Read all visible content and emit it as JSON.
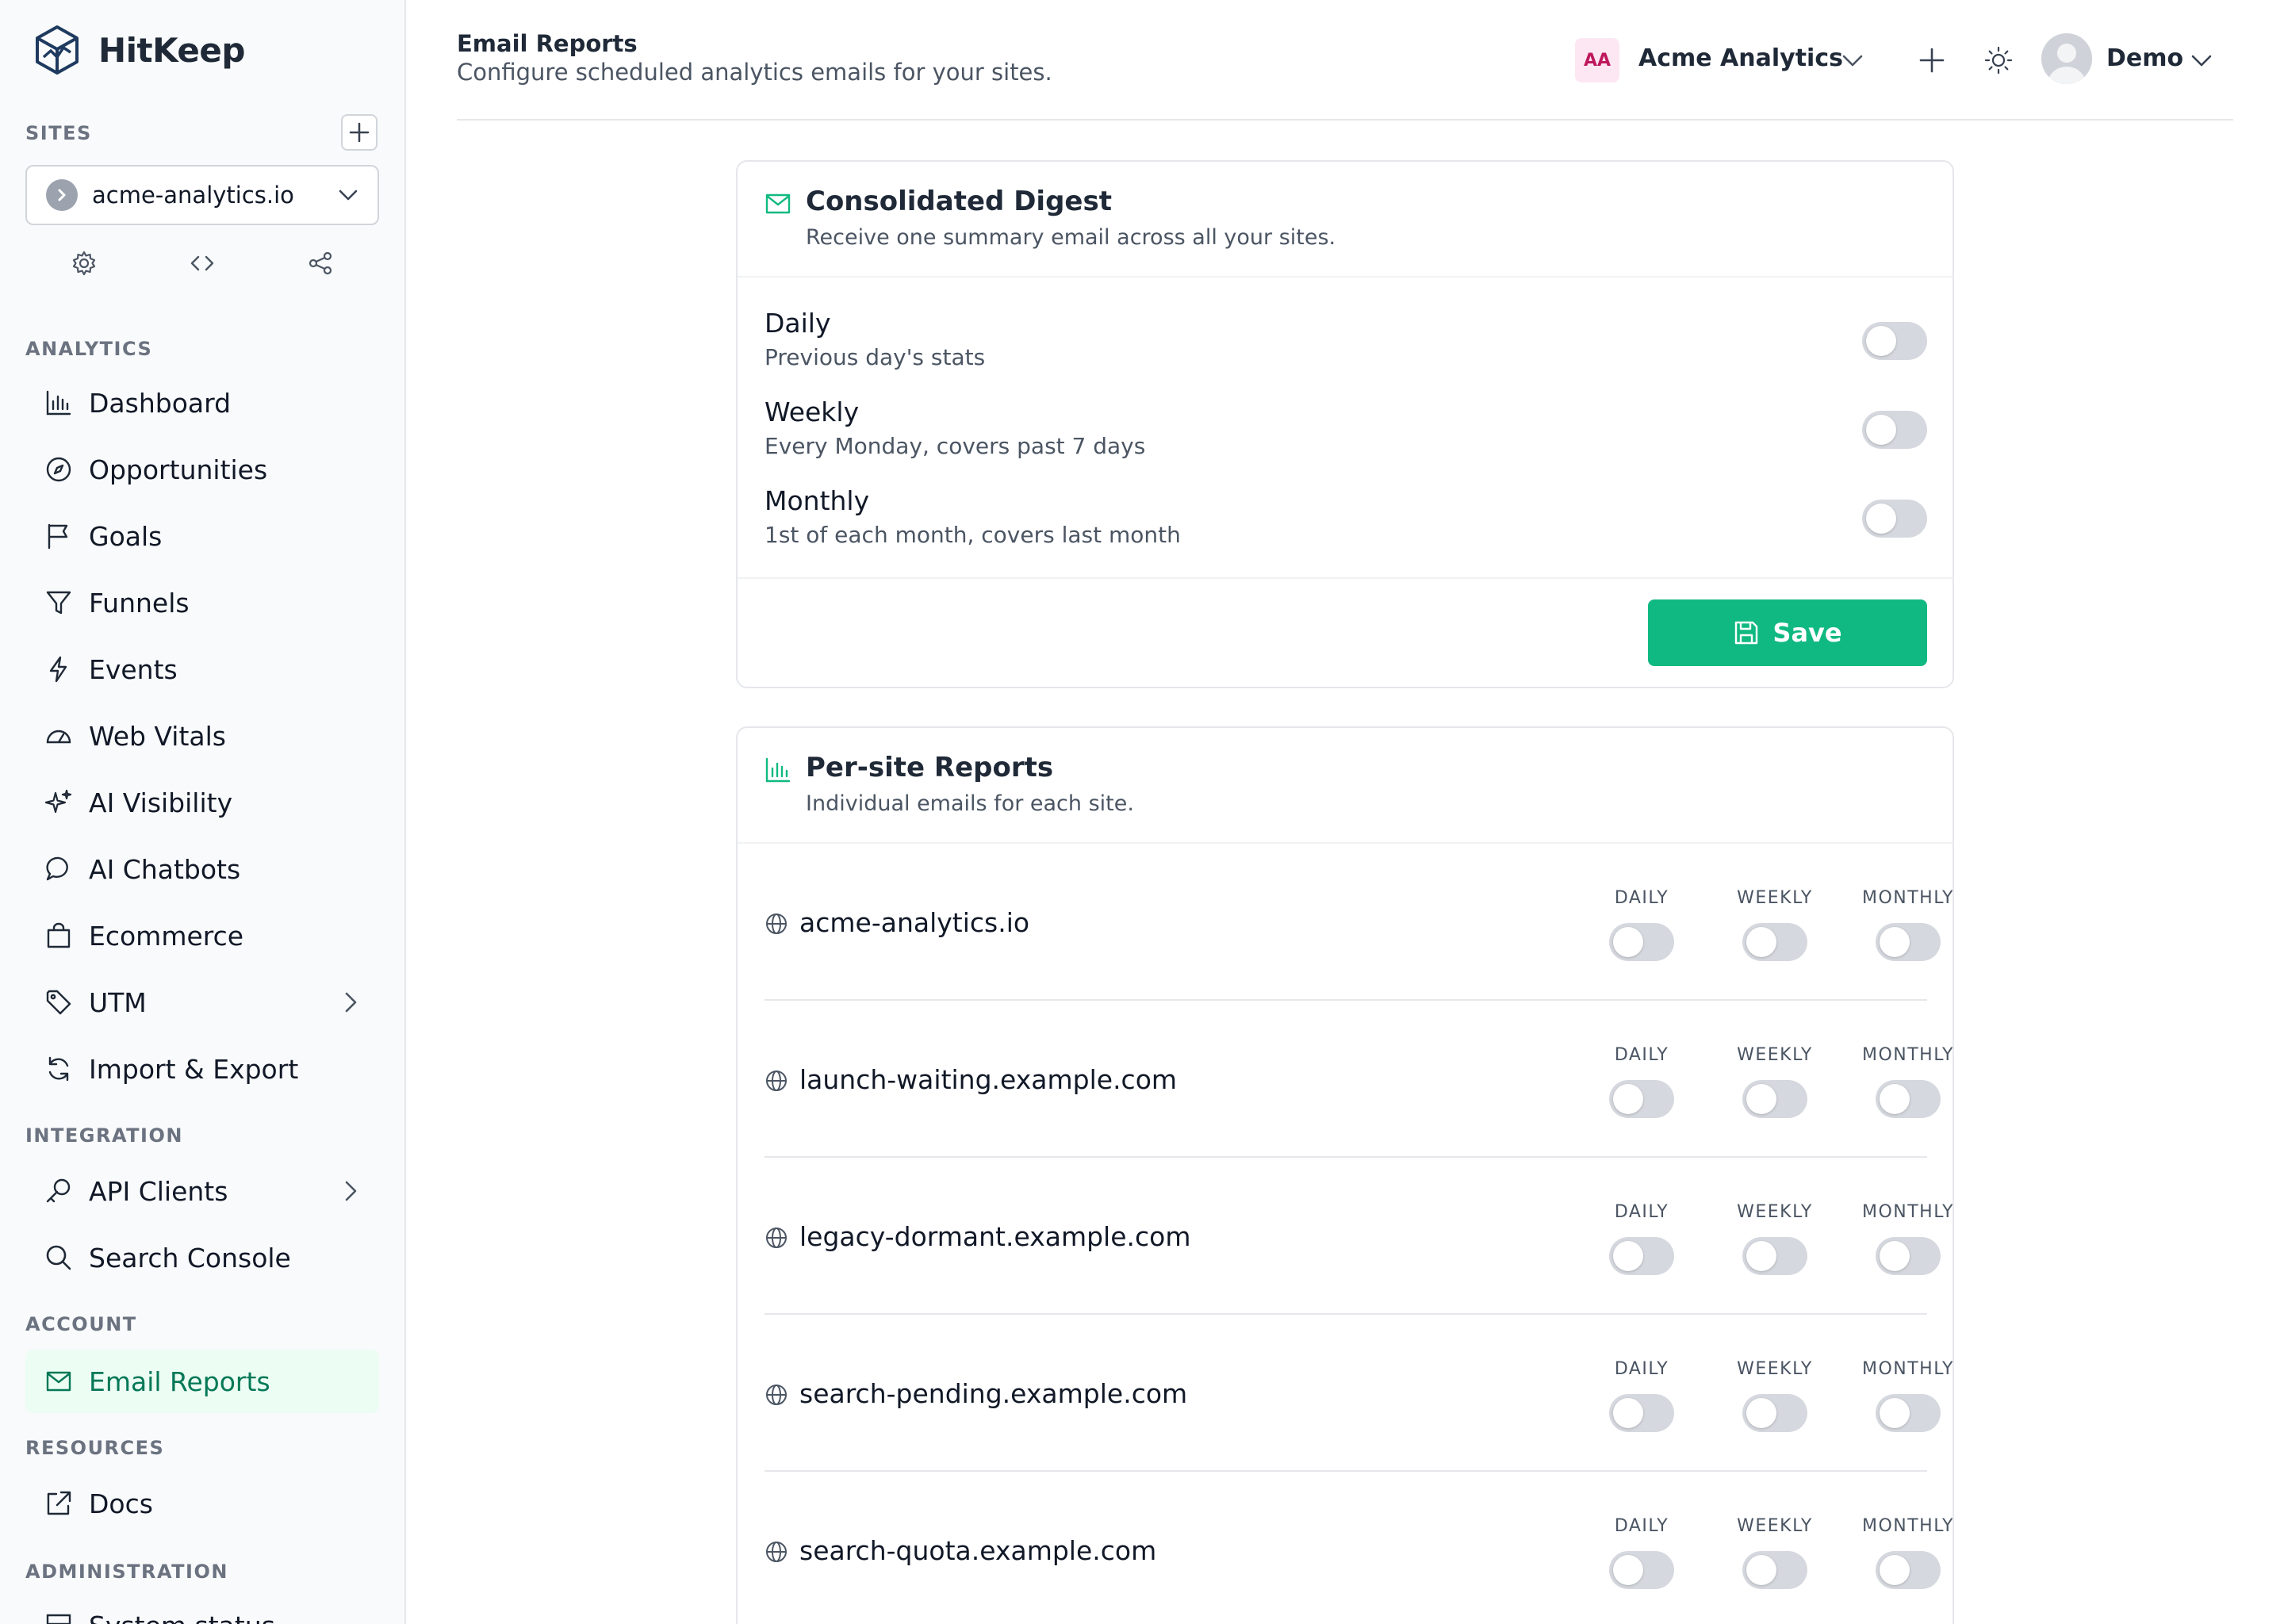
{
  "app": {
    "name": "HitKeep"
  },
  "sidebar": {
    "sites_label": "SITES",
    "selected_site": "acme-analytics.io",
    "sections": {
      "analytics": "ANALYTICS",
      "integration": "INTEGRATION",
      "account": "ACCOUNT",
      "resources": "RESOURCES",
      "administration": "ADMINISTRATION"
    },
    "analytics_items": [
      {
        "label": "Dashboard",
        "icon": "bar-chart-icon"
      },
      {
        "label": "Opportunities",
        "icon": "compass-icon"
      },
      {
        "label": "Goals",
        "icon": "flag-icon"
      },
      {
        "label": "Funnels",
        "icon": "funnel-icon"
      },
      {
        "label": "Events",
        "icon": "bolt-icon"
      },
      {
        "label": "Web Vitals",
        "icon": "gauge-icon"
      },
      {
        "label": "AI Visibility",
        "icon": "sparkles-icon"
      },
      {
        "label": "AI Chatbots",
        "icon": "chat-icon"
      },
      {
        "label": "Ecommerce",
        "icon": "shopping-bag-icon"
      },
      {
        "label": "UTM",
        "icon": "tag-icon"
      },
      {
        "label": "Import & Export",
        "icon": "refresh-icon"
      }
    ],
    "integration_items": [
      {
        "label": "API Clients",
        "icon": "key-icon"
      },
      {
        "label": "Search Console",
        "icon": "search-icon"
      }
    ],
    "account_items": [
      {
        "label": "Email Reports",
        "icon": "mail-icon"
      }
    ],
    "resources_items": [
      {
        "label": "Docs",
        "icon": "external-link-icon"
      }
    ],
    "administration_items": [
      {
        "label": "System status",
        "icon": "server-icon"
      }
    ]
  },
  "header": {
    "title": "Email Reports",
    "subtitle": "Configure scheduled analytics emails for your sites.",
    "org_initials": "AA",
    "org_name": "Acme Analytics",
    "user_name": "Demo"
  },
  "digest": {
    "title": "Consolidated Digest",
    "description": "Receive one summary email across all your sites.",
    "options": [
      {
        "title": "Daily",
        "subtitle": "Previous day's stats",
        "enabled": false
      },
      {
        "title": "Weekly",
        "subtitle": "Every Monday, covers past 7 days",
        "enabled": false
      },
      {
        "title": "Monthly",
        "subtitle": "1st of each month, covers last month",
        "enabled": false
      }
    ],
    "save_label": "Save"
  },
  "per_site": {
    "title": "Per-site Reports",
    "description": "Individual emails for each site.",
    "columns": {
      "daily": "DAILY",
      "weekly": "WEEKLY",
      "monthly": "MONTHLY"
    },
    "sites": [
      {
        "name": "acme-analytics.io",
        "daily": false,
        "weekly": false,
        "monthly": false
      },
      {
        "name": "launch-waiting.example.com",
        "daily": false,
        "weekly": false,
        "monthly": false
      },
      {
        "name": "legacy-dormant.example.com",
        "daily": false,
        "weekly": false,
        "monthly": false
      },
      {
        "name": "search-pending.example.com",
        "daily": false,
        "weekly": false,
        "monthly": false
      },
      {
        "name": "search-quota.example.com",
        "daily": false,
        "weekly": false,
        "monthly": false
      }
    ]
  },
  "colors": {
    "accent": "#10b981",
    "accent_dark": "#047857",
    "active_bg": "#ecfdf3"
  }
}
